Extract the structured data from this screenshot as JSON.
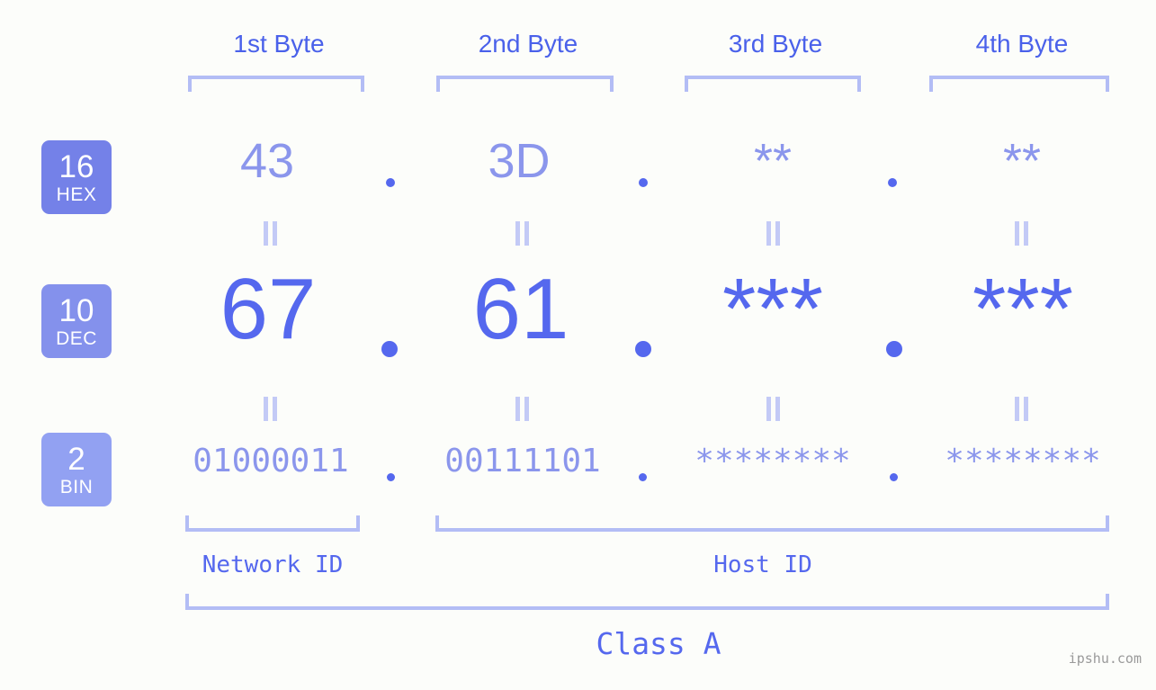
{
  "background_color": "#fcfdfa",
  "accent_color": "#5568ee",
  "muted_accent_color": "#8b96ec",
  "bracket_color": "#b3bdf5",
  "header": {
    "byte_labels": [
      {
        "label": "1st Byte"
      },
      {
        "label": "2nd Byte"
      },
      {
        "label": "3rd Byte"
      },
      {
        "label": "4th Byte"
      }
    ]
  },
  "bases": [
    {
      "num": "16",
      "abbr": "HEX",
      "color": "#7481e8"
    },
    {
      "num": "10",
      "abbr": "DEC",
      "color": "#8491ec"
    },
    {
      "num": "2",
      "abbr": "BIN",
      "color": "#92a1f2"
    }
  ],
  "rows": {
    "hex": {
      "values": [
        "43",
        "3D",
        "**",
        "**"
      ]
    },
    "dec": {
      "values": [
        "67",
        "61",
        "***",
        "***"
      ]
    },
    "bin": {
      "values": [
        "01000011",
        "00111101",
        "********",
        "********"
      ]
    }
  },
  "separators": {
    "dot": ".",
    "equals": "="
  },
  "footer": {
    "network_id_label": "Network ID",
    "host_id_label": "Host ID",
    "class_label": "Class A",
    "watermark": "ipshu.com"
  }
}
